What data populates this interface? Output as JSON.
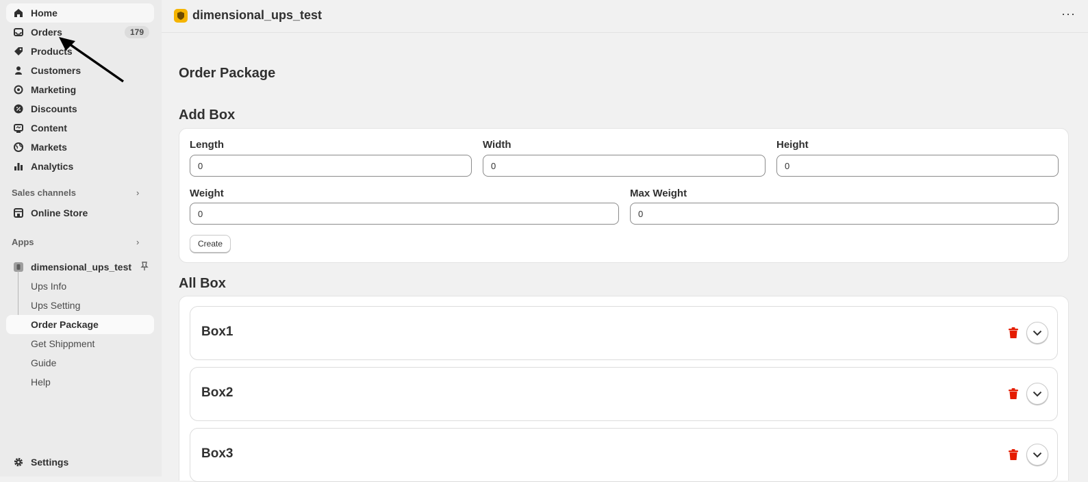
{
  "sidebar": {
    "items": [
      {
        "label": "Home",
        "icon": "home-icon"
      },
      {
        "label": "Orders",
        "icon": "inbox-icon",
        "badge": "179"
      },
      {
        "label": "Products",
        "icon": "tag-icon"
      },
      {
        "label": "Customers",
        "icon": "person-icon"
      },
      {
        "label": "Marketing",
        "icon": "target-icon"
      },
      {
        "label": "Discounts",
        "icon": "discount-icon"
      },
      {
        "label": "Content",
        "icon": "content-icon"
      },
      {
        "label": "Markets",
        "icon": "globe-icon"
      },
      {
        "label": "Analytics",
        "icon": "bar-chart-icon"
      }
    ],
    "sales_channels": {
      "title": "Sales channels",
      "items": [
        {
          "label": "Online Store",
          "icon": "store-icon"
        }
      ]
    },
    "apps": {
      "title": "Apps",
      "app_name": "dimensional_ups_test",
      "sub_items": [
        "Ups Info",
        "Ups Setting",
        "Order Package",
        "Get Shippment",
        "Guide",
        "Help"
      ],
      "active_sub_item": "Order Package"
    },
    "settings_label": "Settings"
  },
  "header": {
    "app_title": "dimensional_ups_test",
    "more_label": "···"
  },
  "page": {
    "title": "Order Package",
    "add_box": {
      "title": "Add Box",
      "fields": {
        "length": {
          "label": "Length",
          "value": "0"
        },
        "width": {
          "label": "Width",
          "value": "0"
        },
        "height": {
          "label": "Height",
          "value": "0"
        },
        "weight": {
          "label": "Weight",
          "value": "0"
        },
        "max_weight": {
          "label": "Max Weight",
          "value": "0"
        }
      },
      "create_label": "Create"
    },
    "all_box": {
      "title": "All Box",
      "boxes": [
        "Box1",
        "Box2",
        "Box3"
      ]
    }
  },
  "colors": {
    "sidebar_bg": "#ebebeb",
    "page_bg": "#f1f1f1",
    "app_logo": "#f5b400",
    "delete": "#e51c00"
  }
}
